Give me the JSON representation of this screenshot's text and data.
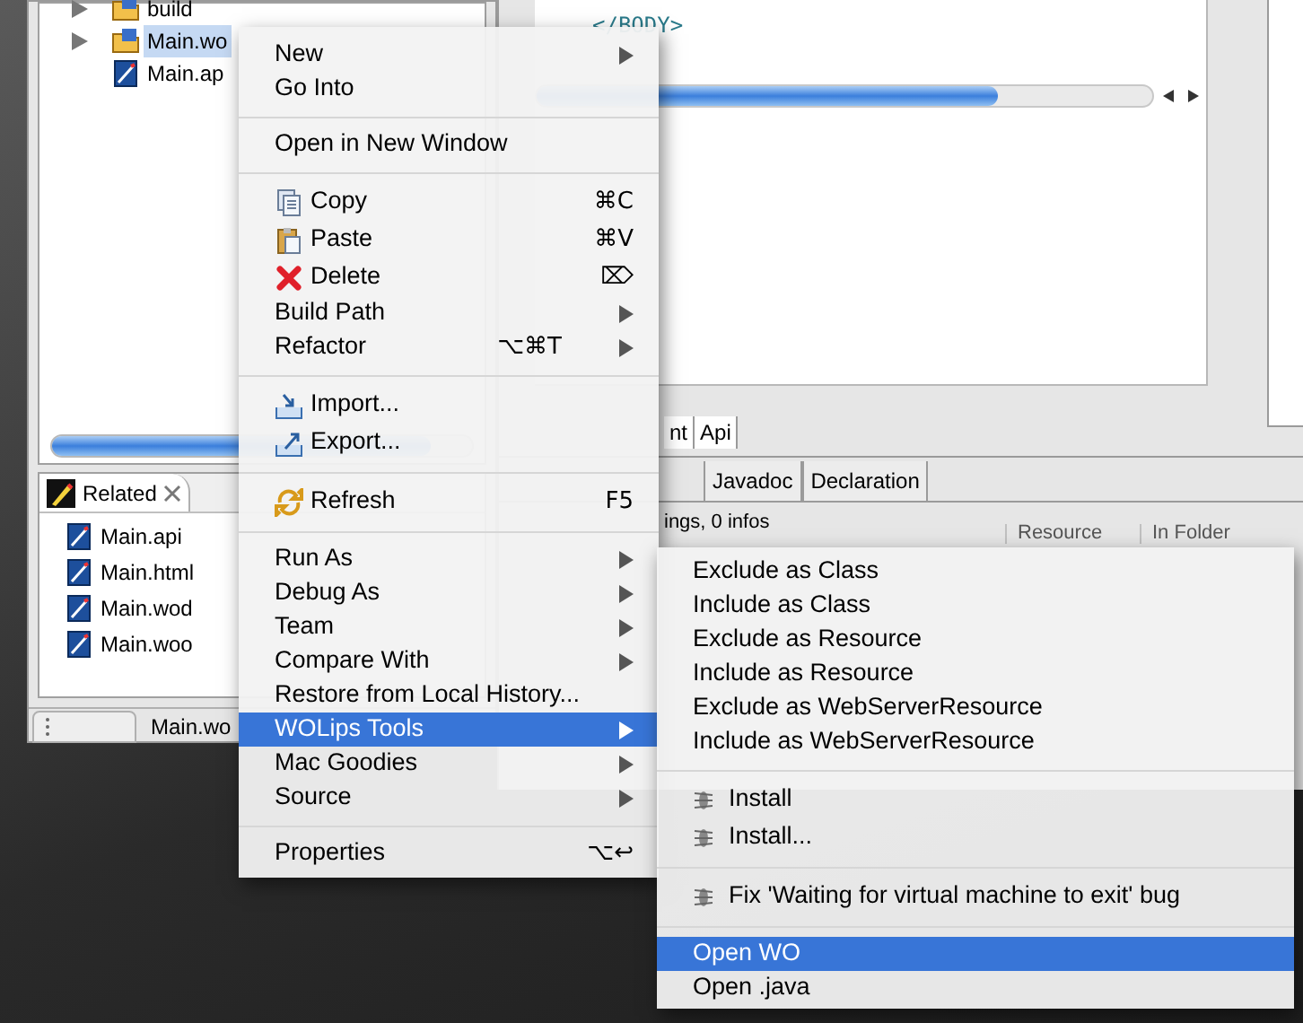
{
  "explorer": {
    "items": [
      {
        "label": "build",
        "expandable": true,
        "selected": false
      },
      {
        "label": "Main.wo",
        "expandable": true,
        "selected": true
      },
      {
        "label": "Main.ap",
        "expandable": false,
        "selected": false
      }
    ]
  },
  "related_view": {
    "title": "Related",
    "items": [
      "Main.api",
      "Main.html",
      "Main.wod",
      "Main.woo"
    ]
  },
  "bottom_tab": "Main.wo",
  "editor": {
    "code_line": "</BODY>",
    "tabs": [
      "nt",
      "Api"
    ]
  },
  "lower_panel": {
    "tabs": [
      "Javadoc",
      "Declaration"
    ],
    "status": "ings, 0 infos",
    "columns": [
      "Resource",
      "In Folder"
    ]
  },
  "context_menu": {
    "items": [
      {
        "kind": "item",
        "label": "New",
        "submenu": true,
        "selected": false
      },
      {
        "kind": "item",
        "label": "Go Into",
        "submenu": false,
        "selected": false
      },
      {
        "kind": "separator"
      },
      {
        "kind": "item",
        "label": "Open in New Window",
        "submenu": false,
        "selected": false
      },
      {
        "kind": "separator"
      },
      {
        "kind": "item",
        "label": "Copy",
        "shortcut": "⌘C",
        "submenu": false,
        "selected": false
      },
      {
        "kind": "item",
        "label": "Paste",
        "shortcut": "⌘V",
        "submenu": false,
        "selected": false
      },
      {
        "kind": "item",
        "label": "Delete",
        "shortcut": "⌦",
        "submenu": false,
        "selected": false
      },
      {
        "kind": "item",
        "label": "Build Path",
        "submenu": true,
        "selected": false
      },
      {
        "kind": "item",
        "label": "Refactor",
        "shortcut": "⌥⌘T",
        "submenu": true,
        "selected": false
      },
      {
        "kind": "separator"
      },
      {
        "kind": "item",
        "label": "Import...",
        "submenu": false,
        "selected": false
      },
      {
        "kind": "item",
        "label": "Export...",
        "submenu": false,
        "selected": false
      },
      {
        "kind": "separator"
      },
      {
        "kind": "item",
        "label": "Refresh",
        "shortcut": "F5",
        "submenu": false,
        "selected": false
      },
      {
        "kind": "separator"
      },
      {
        "kind": "item",
        "label": "Run As",
        "submenu": true,
        "selected": false
      },
      {
        "kind": "item",
        "label": "Debug As",
        "submenu": true,
        "selected": false
      },
      {
        "kind": "item",
        "label": "Team",
        "submenu": true,
        "selected": false
      },
      {
        "kind": "item",
        "label": "Compare With",
        "submenu": true,
        "selected": false
      },
      {
        "kind": "item",
        "label": "Restore from Local History...",
        "submenu": false,
        "selected": false
      },
      {
        "kind": "item",
        "label": "WOLips Tools",
        "submenu": true,
        "selected": true
      },
      {
        "kind": "item",
        "label": "Mac Goodies",
        "submenu": true,
        "selected": false
      },
      {
        "kind": "item",
        "label": "Source",
        "submenu": true,
        "selected": false
      },
      {
        "kind": "separator"
      },
      {
        "kind": "item",
        "label": "Properties",
        "shortcut": "⌥↩",
        "submenu": false,
        "selected": false
      }
    ]
  },
  "submenu": {
    "items": [
      {
        "kind": "item",
        "label": "Exclude as Class",
        "selected": false
      },
      {
        "kind": "item",
        "label": "Include as Class",
        "selected": false
      },
      {
        "kind": "item",
        "label": "Exclude as Resource",
        "selected": false
      },
      {
        "kind": "item",
        "label": "Include as Resource",
        "selected": false
      },
      {
        "kind": "item",
        "label": "Exclude as WebServerResource",
        "selected": false
      },
      {
        "kind": "item",
        "label": "Include as WebServerResource",
        "selected": false
      },
      {
        "kind": "separator"
      },
      {
        "kind": "item",
        "label": "Install",
        "selected": false
      },
      {
        "kind": "item",
        "label": "Install...",
        "selected": false
      },
      {
        "kind": "separator"
      },
      {
        "kind": "item",
        "label": "Fix 'Waiting for virtual machine to exit' bug",
        "selected": false
      },
      {
        "kind": "separator"
      },
      {
        "kind": "item",
        "label": "Open WO",
        "selected": true
      },
      {
        "kind": "item",
        "label": "Open .java",
        "selected": false
      }
    ]
  }
}
